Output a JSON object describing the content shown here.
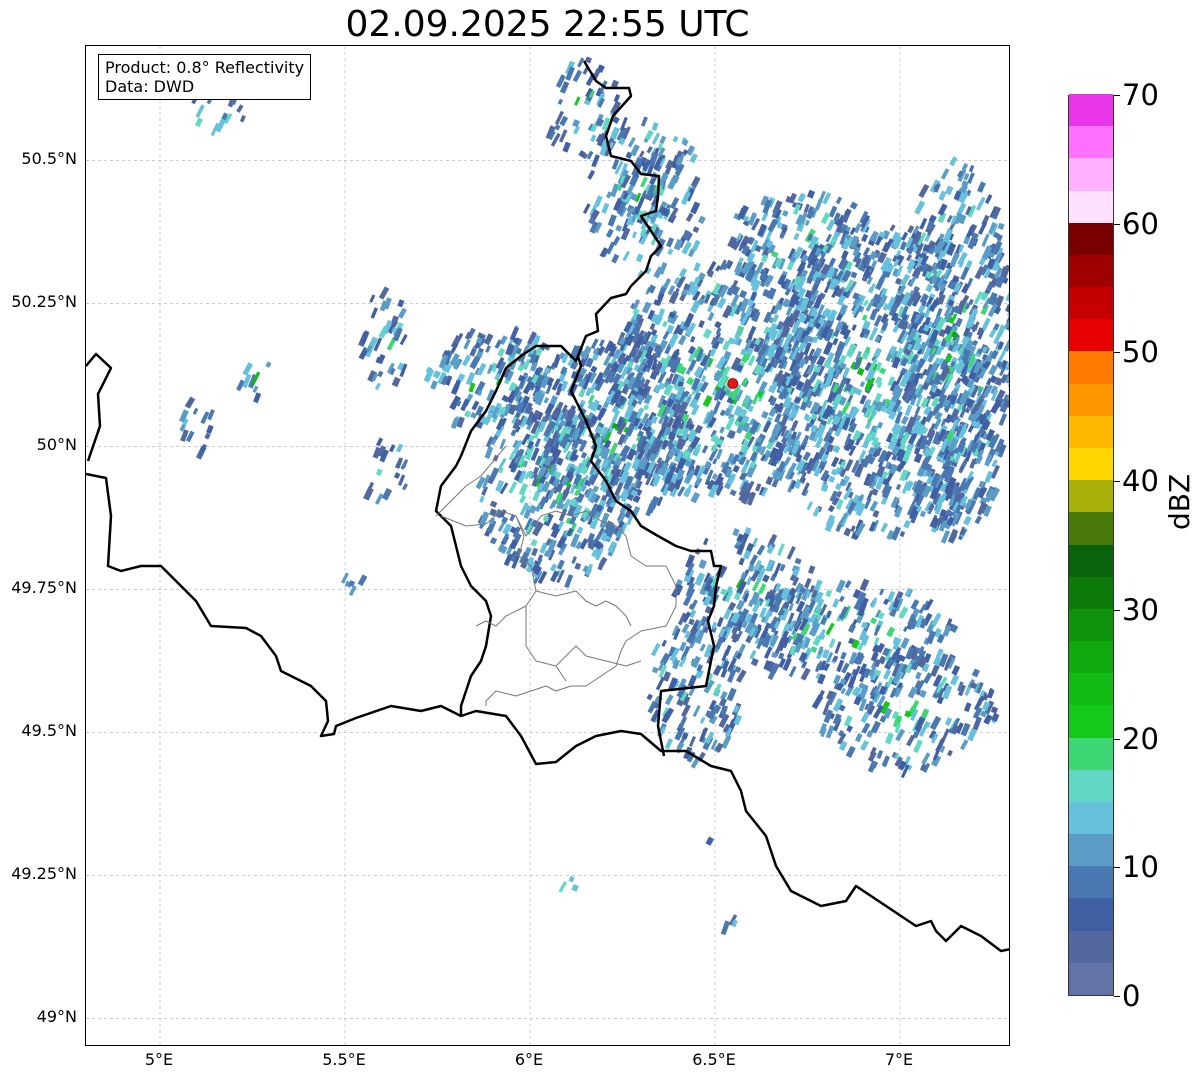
{
  "title": "02.09.2025 22:55 UTC",
  "info": {
    "product": "Product: 0.8° Reflectivity",
    "data": "Data: DWD"
  },
  "map": {
    "lon_range": [
      4.8,
      7.3
    ],
    "lat_range": [
      48.95,
      50.7
    ],
    "lat_ticks": [
      {
        "value": 50.5,
        "label": "50.5°N"
      },
      {
        "value": 50.25,
        "label": "50.25°N"
      },
      {
        "value": 50.0,
        "label": "50°N"
      },
      {
        "value": 49.75,
        "label": "49.75°N"
      },
      {
        "value": 49.5,
        "label": "49.5°N"
      },
      {
        "value": 49.25,
        "label": "49.25°N"
      },
      {
        "value": 49.0,
        "label": "49°N"
      }
    ],
    "lon_ticks": [
      {
        "value": 5.0,
        "label": "5°E"
      },
      {
        "value": 5.5,
        "label": "5.5°E"
      },
      {
        "value": 6.0,
        "label": "6°E"
      },
      {
        "value": 6.5,
        "label": "6.5°E"
      },
      {
        "value": 7.0,
        "label": "7°E"
      }
    ],
    "radar_site": {
      "lon": 6.548,
      "lat": 50.11,
      "color": "#e8141c"
    },
    "grid": true
  },
  "colorbar": {
    "label": "dBZ",
    "min": 0,
    "max": 70,
    "ticks": [
      {
        "value": 70,
        "label": "70"
      },
      {
        "value": 60,
        "label": "60"
      },
      {
        "value": 50,
        "label": "50"
      },
      {
        "value": 40,
        "label": "40"
      },
      {
        "value": 30,
        "label": "30"
      },
      {
        "value": 20,
        "label": "20"
      },
      {
        "value": 10,
        "label": "10"
      },
      {
        "value": 0,
        "label": "0"
      }
    ],
    "colors": [
      "#6473a7",
      "#5468a0",
      "#4160a3",
      "#4a78b0",
      "#5a9cc6",
      "#66c1dc",
      "#62d8c4",
      "#3fd676",
      "#14c81c",
      "#12bb14",
      "#0fa80f",
      "#0e920e",
      "#0b7a0b",
      "#09630a",
      "#4a7a0a",
      "#a8b00a",
      "#ffd600",
      "#ffb800",
      "#ff9800",
      "#ff7a00",
      "#e60000",
      "#c40000",
      "#a00000",
      "#7a0000",
      "#ffe0ff",
      "#ffb0ff",
      "#ff70ff",
      "#e936e9"
    ]
  },
  "chart_data": {
    "type": "map",
    "title": "02.09.2025 22:55 UTC",
    "ylabel": "",
    "xlabel": "",
    "colorbar_label": "dBZ",
    "colorbar_range": [
      0,
      70
    ],
    "echo_clusters": [
      {
        "lon": 6.5,
        "lat": 50.2,
        "dbz": 20
      },
      {
        "lon": 6.9,
        "lat": 50.1,
        "dbz": 22
      },
      {
        "lon": 7.15,
        "lat": 50.15,
        "dbz": 22
      },
      {
        "lon": 6.05,
        "lat": 50.0,
        "dbz": 15
      },
      {
        "lon": 5.75,
        "lat": 50.2,
        "dbz": 20
      },
      {
        "lon": 6.5,
        "lat": 49.7,
        "dbz": 15
      },
      {
        "lon": 6.95,
        "lat": 49.65,
        "dbz": 12
      },
      {
        "lon": 5.15,
        "lat": 50.6,
        "dbz": 15
      }
    ]
  }
}
